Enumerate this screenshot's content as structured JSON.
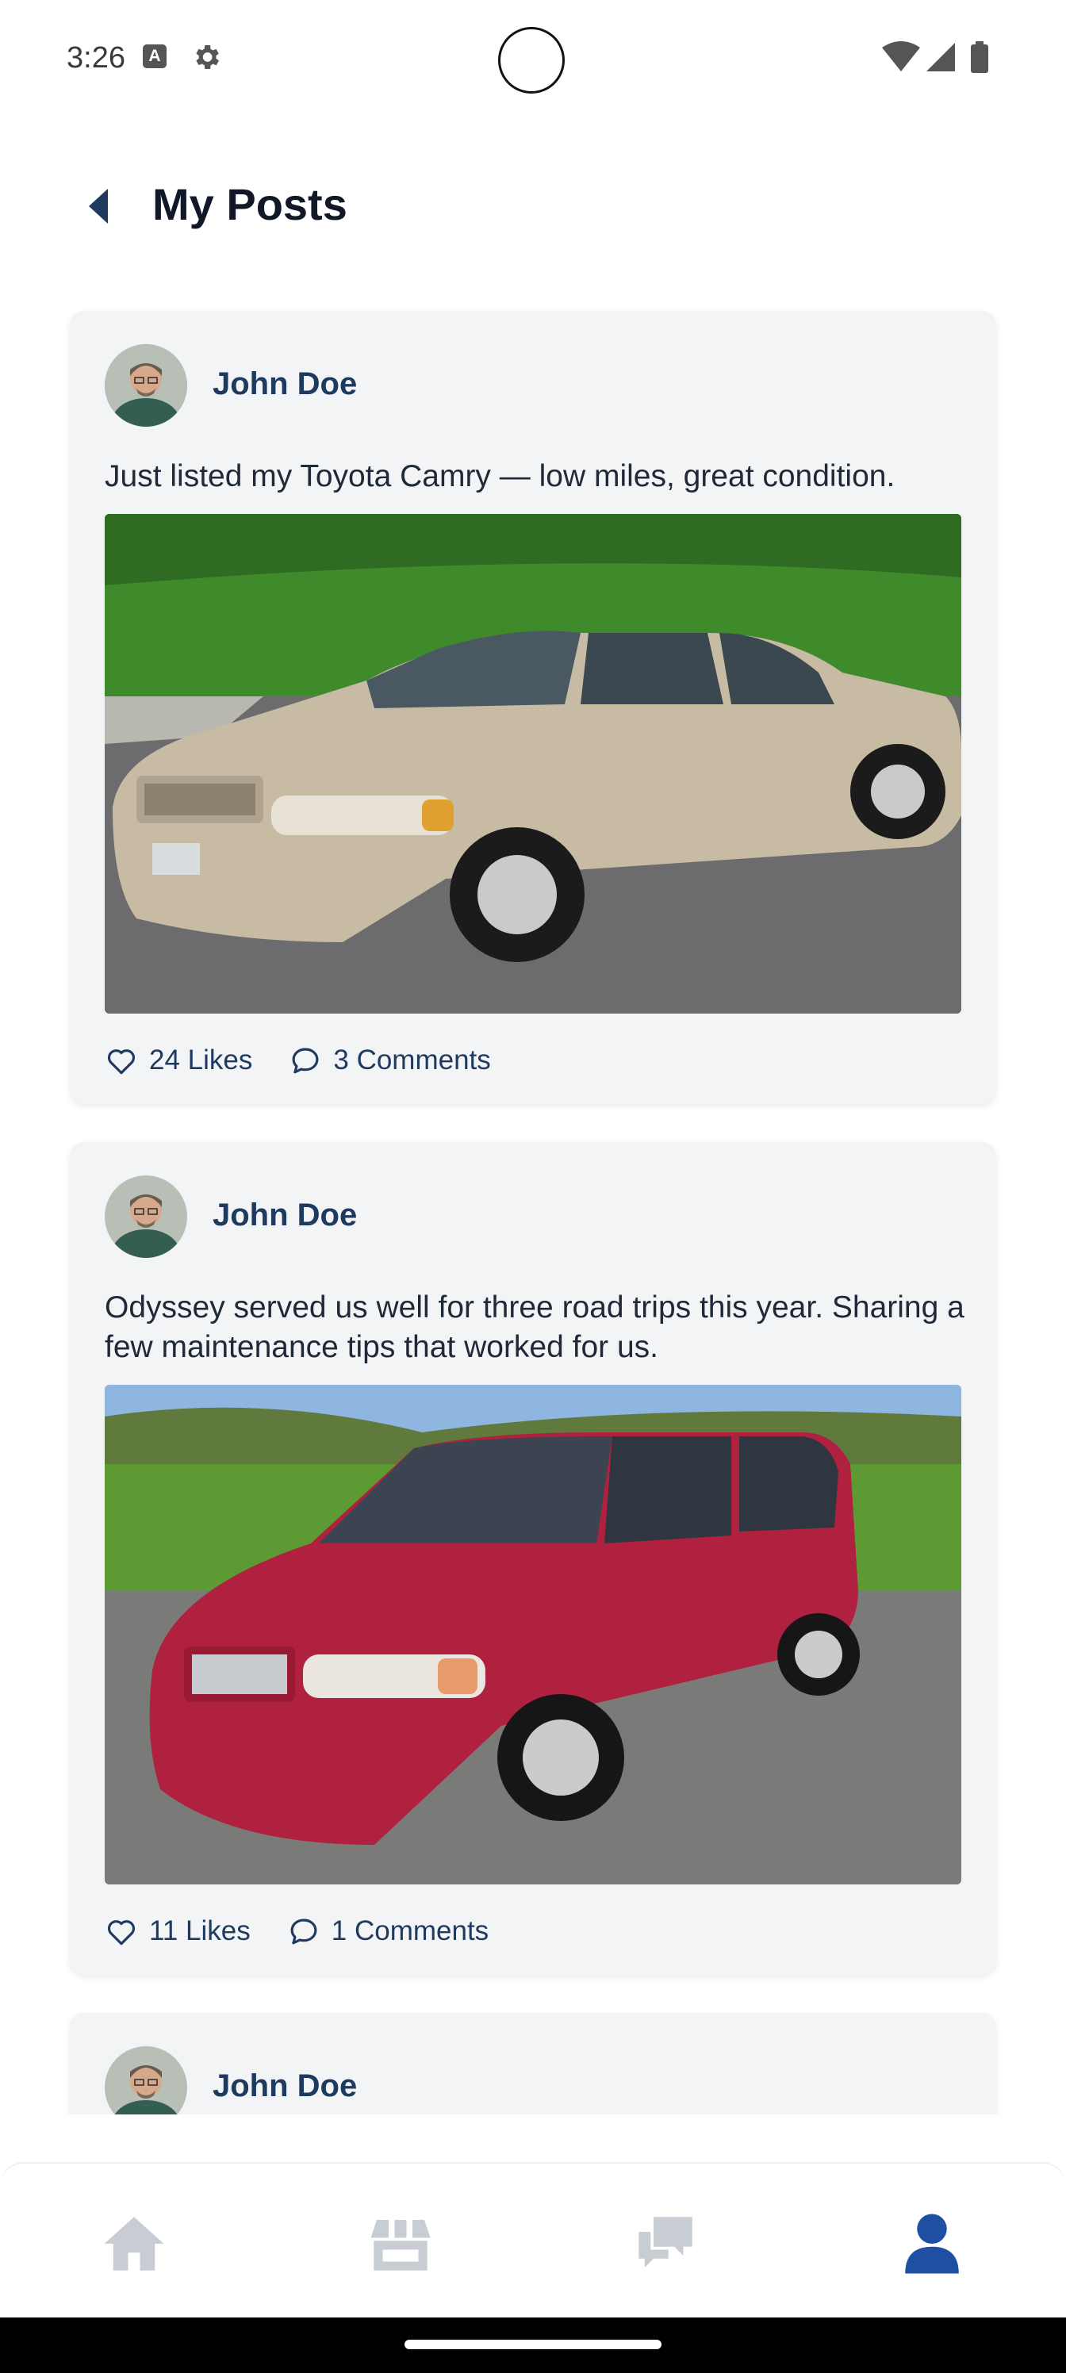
{
  "status_bar": {
    "time": "3:26",
    "a_badge": "A",
    "icons": [
      "gear-icon",
      "wifi-icon",
      "signal-icon",
      "battery-icon"
    ]
  },
  "header": {
    "title": "My Posts",
    "back_icon": "back-arrow-icon"
  },
  "posts": [
    {
      "author": "John Doe",
      "text": "Just listed my Toyota Camry — low miles, great condition.",
      "image": "beige Toyota Camry sedan",
      "likes": "24 Likes",
      "comments": "3 Comments"
    },
    {
      "author": "John Doe",
      "text": "Odyssey served us well for three road trips this year. Sharing a few maintenance tips that worked for us.",
      "image": "red Honda Odyssey minivan",
      "likes": "11 Likes",
      "comments": "1 Comments"
    },
    {
      "author": "John Doe"
    }
  ],
  "bottom_nav": {
    "items": [
      {
        "icon": "home-icon",
        "active": false
      },
      {
        "icon": "store-icon",
        "active": false
      },
      {
        "icon": "chat-icon",
        "active": false
      },
      {
        "icon": "profile-icon",
        "active": true
      }
    ],
    "active_color": "#1e4fa3",
    "inactive_color": "#c8cdd3"
  },
  "colors": {
    "accent": "#1e3a5f",
    "card_bg": "#f3f4f6"
  }
}
